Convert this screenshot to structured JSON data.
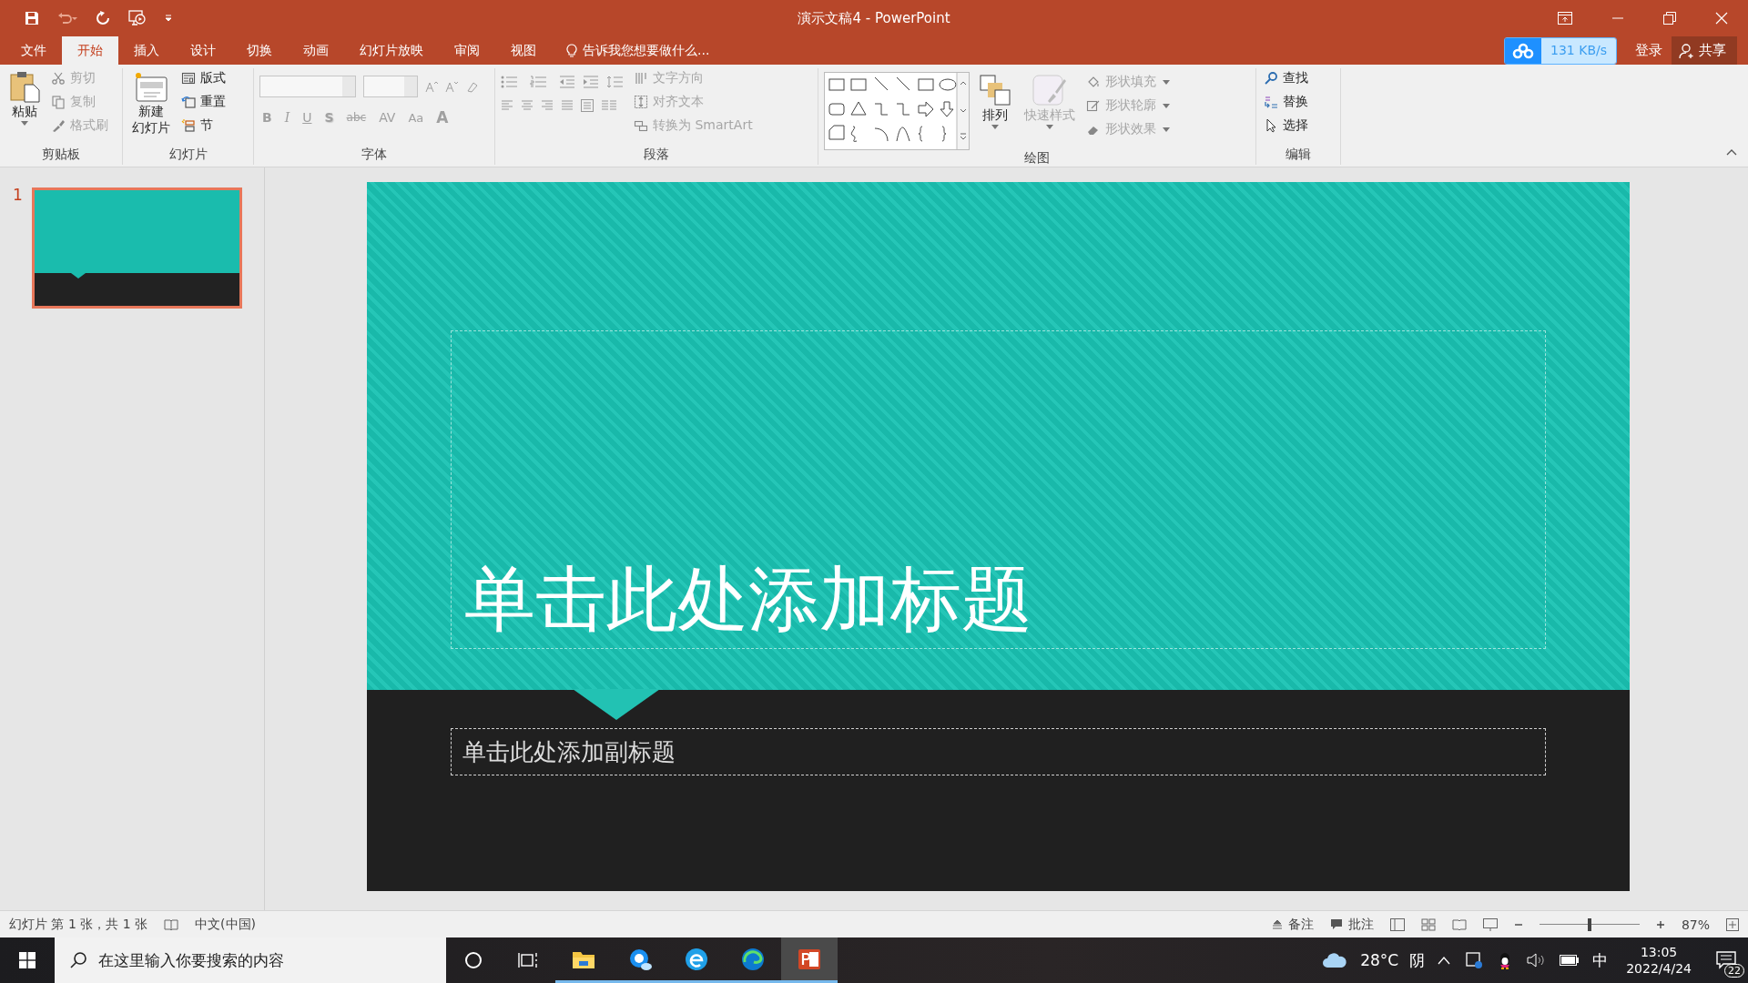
{
  "window": {
    "title": "演示文稿4 - PowerPoint"
  },
  "menu_tabs": [
    {
      "label": "文件",
      "selected": false
    },
    {
      "label": "开始",
      "selected": true
    },
    {
      "label": "插入",
      "selected": false
    },
    {
      "label": "设计",
      "selected": false
    },
    {
      "label": "切换",
      "selected": false
    },
    {
      "label": "动画",
      "selected": false
    },
    {
      "label": "幻灯片放映",
      "selected": false
    },
    {
      "label": "审阅",
      "selected": false
    },
    {
      "label": "视图",
      "selected": false
    }
  ],
  "tell_me": "告诉我您想要做什么...",
  "download_speed": "131 KB/s",
  "sign_in": "登录",
  "share": "共享",
  "ribbon": {
    "clipboard": {
      "label": "剪贴板",
      "paste": {
        "label": "粘贴",
        "disabled": false
      },
      "items": [
        {
          "label": "剪切",
          "disabled": true
        },
        {
          "label": "复制",
          "disabled": true
        },
        {
          "label": "格式刷",
          "disabled": true
        }
      ]
    },
    "slides": {
      "label": "幻灯片",
      "new_slide": {
        "label": [
          "新建",
          "幻灯片"
        ],
        "disabled": false
      },
      "items": [
        {
          "label": "版式",
          "disabled": false
        },
        {
          "label": "重置",
          "disabled": false
        },
        {
          "label": "节",
          "disabled": false
        }
      ]
    },
    "font": {
      "label": "字体",
      "disabled": true,
      "buttons": [
        {
          "label": "B"
        },
        {
          "label": "I"
        },
        {
          "label": "U"
        },
        {
          "label": "S"
        },
        {
          "label": "abc"
        },
        {
          "label": "AV"
        },
        {
          "label": "Aa"
        },
        {
          "label": "A"
        }
      ]
    },
    "paragraph": {
      "label": "段落",
      "items": [
        {
          "label": "文字方向",
          "disabled": true
        },
        {
          "label": "对齐文本",
          "disabled": true
        },
        {
          "label": "转换为 SmartArt",
          "disabled": true
        }
      ]
    },
    "drawing": {
      "label": "绘图",
      "arrange": {
        "label": "排列",
        "disabled": false
      },
      "quick_styles": {
        "label": "快速样式",
        "disabled": true
      },
      "items": [
        {
          "label": "形状填充",
          "disabled": true
        },
        {
          "label": "形状轮廓",
          "disabled": true
        },
        {
          "label": "形状效果",
          "disabled": true
        }
      ]
    },
    "editing": {
      "label": "编辑",
      "items": [
        {
          "label": "查找",
          "disabled": false
        },
        {
          "label": "替换",
          "disabled": false
        },
        {
          "label": "选择",
          "disabled": false
        }
      ]
    }
  },
  "slides_panel": [
    {
      "number": "1",
      "selected": true
    }
  ],
  "slide": {
    "title_placeholder": "单击此处添加标题",
    "subtitle_placeholder": "单击此处添加副标题"
  },
  "status_bar": {
    "slide_info": "幻灯片 第 1 张，共 1 张",
    "language": "中文(中国)",
    "notes": "备注",
    "comments": "批注",
    "zoom": {
      "level": 0.5
    },
    "zoom_percent": "87%"
  },
  "taskbar": {
    "search_placeholder": "在这里输入你要搜索的内容",
    "apps": [
      {
        "running": true,
        "selected": false
      },
      {
        "running": true,
        "selected": false
      },
      {
        "running": true,
        "selected": false
      },
      {
        "running": true,
        "selected": false
      },
      {
        "running": true,
        "selected": true
      }
    ],
    "temperature": "28°C",
    "weather": "阴",
    "ime": "中",
    "time": "13:05",
    "date": "2022/4/24",
    "notifications": "22"
  }
}
